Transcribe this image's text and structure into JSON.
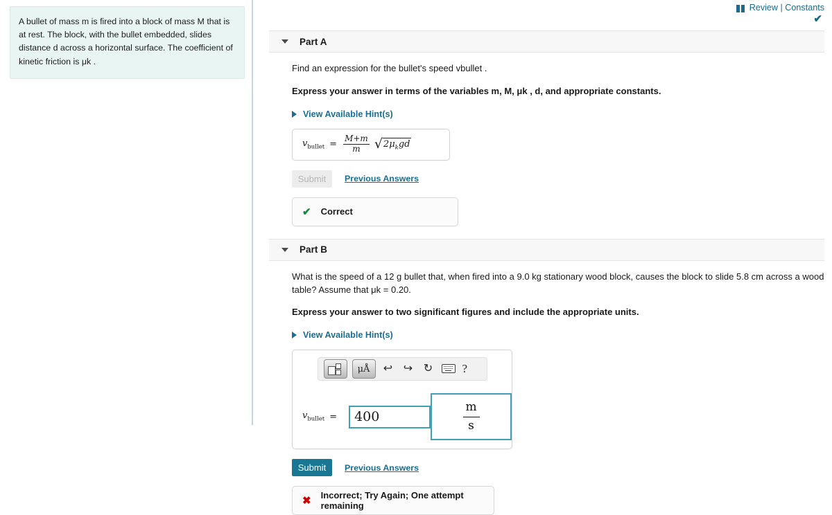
{
  "problem": {
    "text": "A bullet of mass m is fired into a block of mass M that is at rest. The block, with the bullet embedded, slides distance d across a horizontal surface. The coefficient of kinetic friction is μk ."
  },
  "header": {
    "review_label": "Review | Constants",
    "book_icon": "book-icon",
    "status_check": "✔"
  },
  "part_a": {
    "title": "Part A",
    "caret_icon": "chevron-down-icon",
    "question": "Find an expression for the bullet's speed vbullet .",
    "instruction": "Express your answer in terms of the variables m, M, μk , d, and appropriate constants.",
    "hints_label": "View Available Hint(s)",
    "answer": {
      "lhs": "v",
      "lhs_sub": "bullet",
      "equals": "=",
      "fraction_numerator": "M+m",
      "fraction_denominator": "m",
      "radicand_prefix": "2",
      "radicand_mu": "μ",
      "radicand_mu_sub": "k",
      "radicand_suffix": "gd"
    },
    "submit_label": "Submit",
    "submit_disabled": true,
    "previous_answers_label": "Previous Answers",
    "feedback": {
      "icon": "check-icon",
      "text": "Correct",
      "color": "#17893b"
    }
  },
  "part_b": {
    "title": "Part B",
    "caret_icon": "chevron-down-icon",
    "question": "What is the speed of a 12 g bullet that, when fired into a 9.0 kg stationary wood block, causes the block to slide 5.8 cm across a wood table? Assume that μk = 0.20.",
    "instruction": "Express your answer to two significant figures and include the appropriate units.",
    "hints_label": "View Available Hint(s)",
    "toolbar": {
      "template_button": "math-template-icon",
      "units_button": "μÅ",
      "undo_icon": "↩",
      "redo_icon": "↪",
      "reset_icon": "↻",
      "keyboard_icon": "keyboard-icon",
      "help_icon": "?"
    },
    "answer": {
      "lhs": "v",
      "lhs_sub": "bullet",
      "equals": "=",
      "value": "400",
      "placeholder": "",
      "unit_numerator": "m",
      "unit_denominator": "s"
    },
    "submit_label": "Submit",
    "submit_disabled": false,
    "previous_answers_label": "Previous Answers",
    "feedback": {
      "icon": "cross-icon",
      "text": "Incorrect; Try Again; One attempt remaining",
      "color": "#cc0000"
    }
  },
  "colors": {
    "accent_teal": "#1a7794",
    "link_blue": "#1b6e92",
    "problem_bg": "#e8f5f3",
    "input_border": "#41a0b8",
    "correct_green": "#17893b",
    "incorrect_red": "#cc0000"
  }
}
